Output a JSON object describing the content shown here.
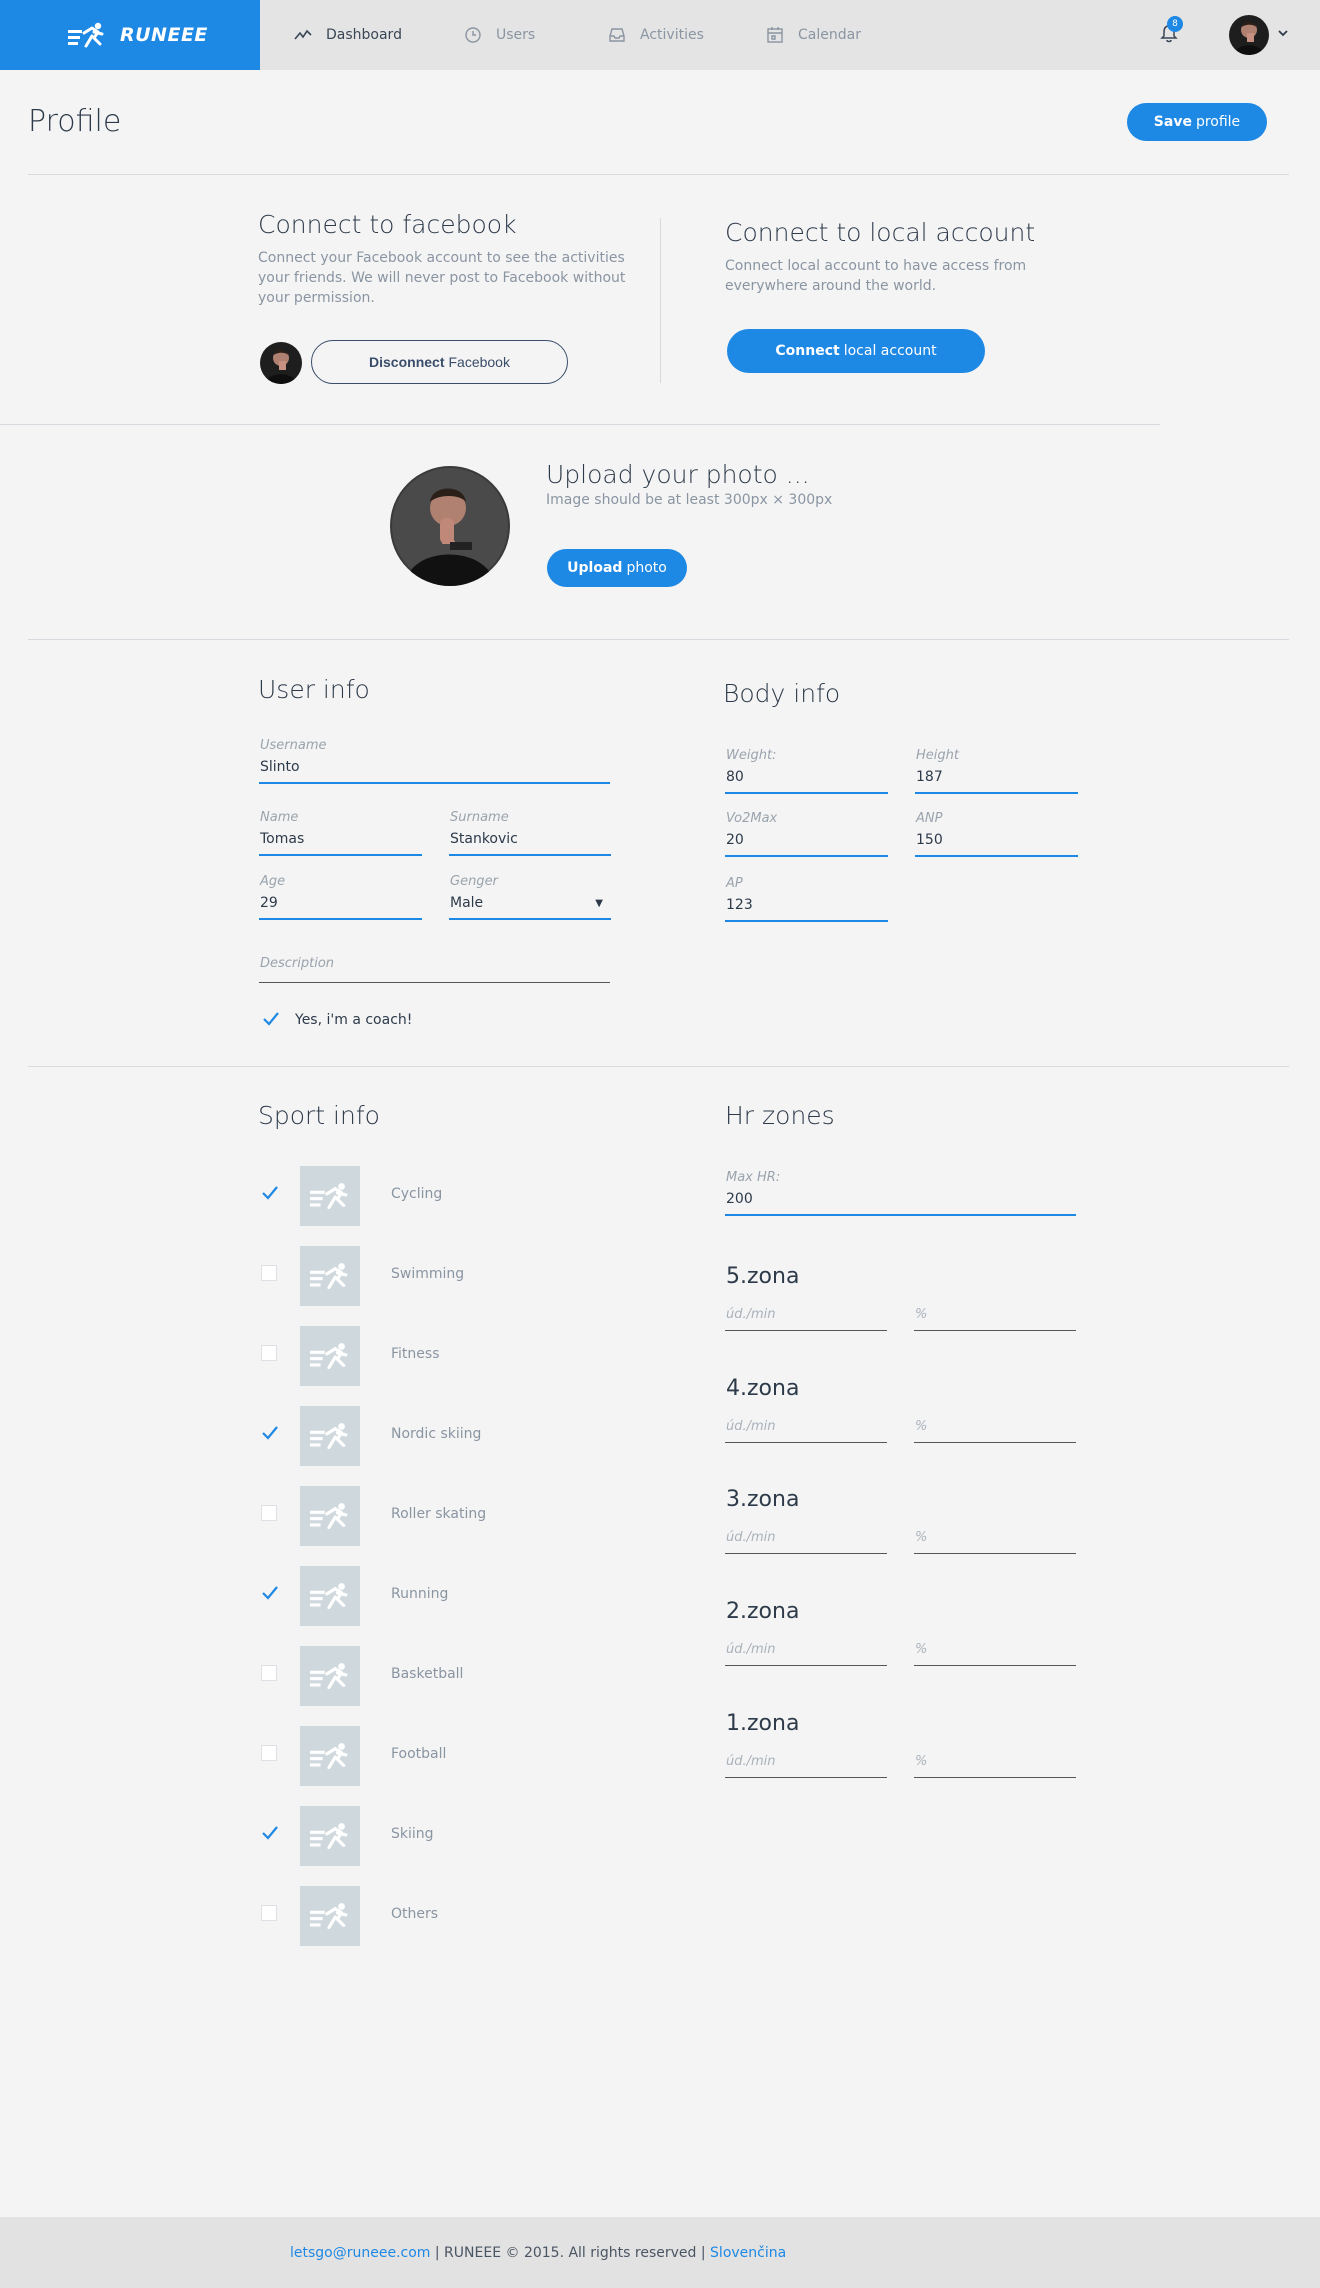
{
  "nav": {
    "brand": "RUNEEE",
    "items": [
      {
        "label": "Dashboard",
        "icon": "activity-line-icon"
      },
      {
        "label": "Users",
        "icon": "clock-icon"
      },
      {
        "label": "Activities",
        "icon": "inbox-icon"
      },
      {
        "label": "Calendar",
        "icon": "calendar-icon"
      }
    ],
    "notifications": "8"
  },
  "page": {
    "title": "Profile",
    "save_bold": "Save",
    "save_rest": "profile"
  },
  "facebook": {
    "title": "Connect to facebook",
    "text": "Connect your Facebook account to see the activities your friends. We will never post to Facebook without your permission.",
    "btn_bold": "Disconnect",
    "btn_rest": "Facebook"
  },
  "local": {
    "title": "Connect to local account",
    "text": "Connect local account to have access from everywhere around the world.",
    "btn_bold": "Connect",
    "btn_rest": "local account"
  },
  "photo": {
    "title": "Upload your photo ...",
    "hint": "Image should be at least 300px × 300px",
    "btn_bold": "Upload",
    "btn_rest": "photo"
  },
  "user_info": {
    "title": "User info",
    "username_label": "Username",
    "username": "Slinto",
    "name_label": "Name",
    "name": "Tomas",
    "surname_label": "Surname",
    "surname": "Stankovic",
    "age_label": "Age",
    "age": "29",
    "gender_label": "Genger",
    "gender": "Male",
    "description_label": "Description",
    "coach_label": "Yes, i'm a coach!",
    "coach_checked": true
  },
  "body_info": {
    "title": "Body info",
    "weight_label": "Weight:",
    "weight": "80",
    "height_label": "Height",
    "height": "187",
    "vo2_label": "Vo2Max",
    "vo2": "20",
    "anp_label": "ANP",
    "anp": "150",
    "ap_label": "AP",
    "ap": "123"
  },
  "sport_info": {
    "title": "Sport info",
    "sports": [
      {
        "name": "Cycling",
        "checked": true
      },
      {
        "name": "Swimming",
        "checked": false
      },
      {
        "name": "Fitness",
        "checked": false
      },
      {
        "name": "Nordic skiing",
        "checked": true
      },
      {
        "name": "Roller skating",
        "checked": false
      },
      {
        "name": "Running",
        "checked": true
      },
      {
        "name": "Basketball",
        "checked": false
      },
      {
        "name": "Football",
        "checked": false
      },
      {
        "name": "Skiing",
        "checked": true
      },
      {
        "name": "Others",
        "checked": false
      }
    ]
  },
  "hr_zones": {
    "title": "Hr zones",
    "maxhr_label": "Max HR:",
    "maxhr": "200",
    "zones": [
      {
        "title": "5.zona",
        "bpm_ph": "úd./min",
        "pct_ph": "%"
      },
      {
        "title": "4.zona",
        "bpm_ph": "úd./min",
        "pct_ph": "%"
      },
      {
        "title": "3.zona",
        "bpm_ph": "úd./min",
        "pct_ph": "%"
      },
      {
        "title": "2.zona",
        "bpm_ph": "úd./min",
        "pct_ph": "%"
      },
      {
        "title": "1.zona",
        "bpm_ph": "úd./min",
        "pct_ph": "%"
      }
    ]
  },
  "footer": {
    "email": "letsgo@runeee.com",
    "middle": " | RUNEEE © 2015. All rights reserved | ",
    "lang": "Slovenčina"
  },
  "colors": {
    "accent": "#1e88e5",
    "sport_tile": "#cfd8dc"
  }
}
